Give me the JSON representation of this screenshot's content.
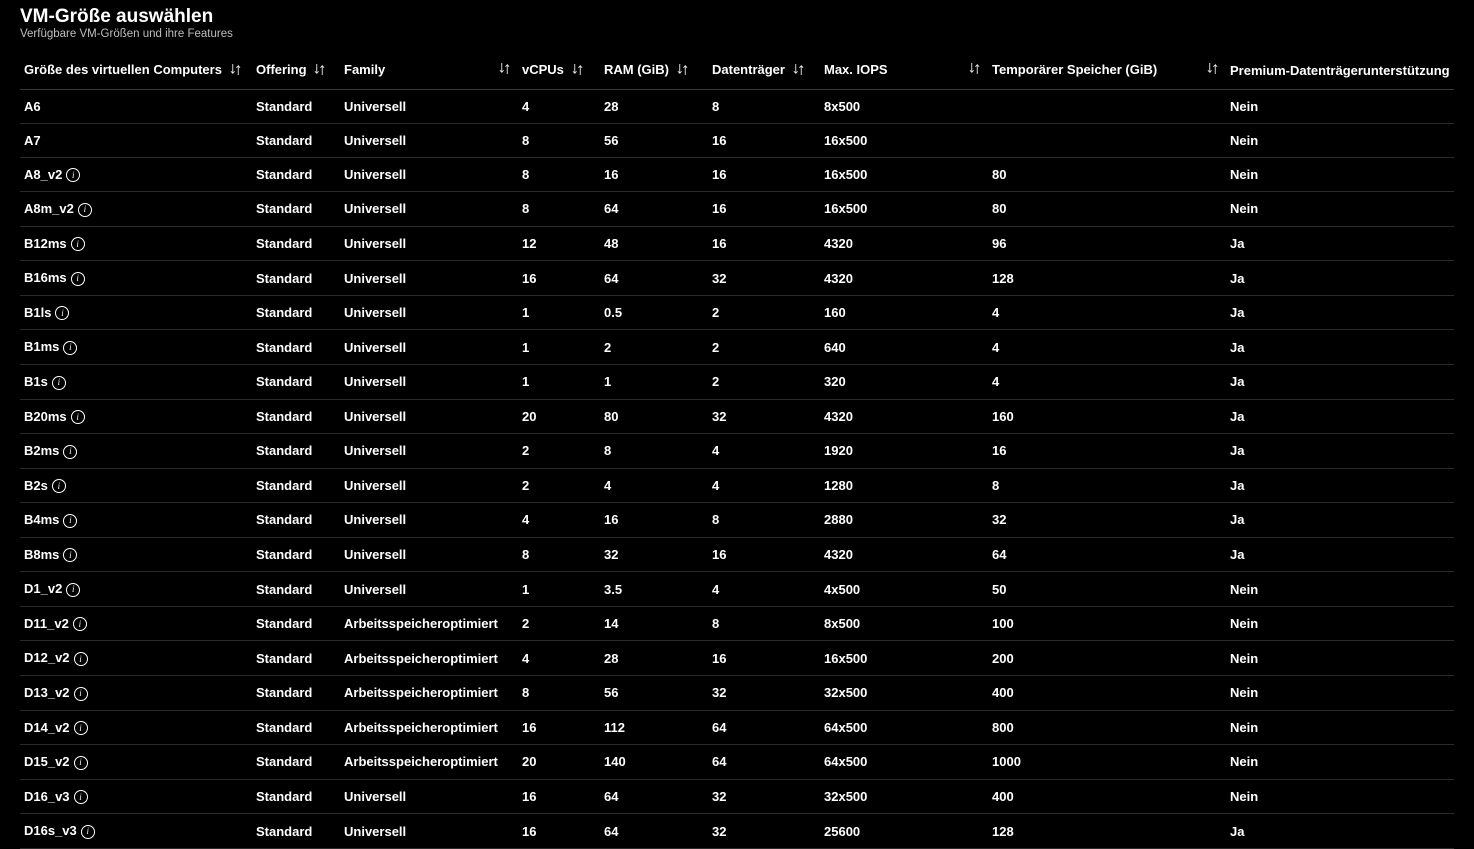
{
  "header": {
    "title": "VM-Größe auswählen",
    "subtitle": "Verfügbare VM-Größen und ihre Features"
  },
  "columns": {
    "size": {
      "label": "Größe des virtuellen Computers",
      "sortable": true,
      "sort_align": "left"
    },
    "offering": {
      "label": "Offering",
      "sortable": true,
      "sort_align": "left"
    },
    "family": {
      "label": "Family",
      "sortable": true,
      "sort_align": "right"
    },
    "vcpus": {
      "label": "vCPUs",
      "sortable": true,
      "sort_align": "left"
    },
    "ram": {
      "label": "RAM (GiB)",
      "sortable": true,
      "sort_align": "left"
    },
    "disks": {
      "label": "Datenträger",
      "sortable": true,
      "sort_align": "left"
    },
    "iops": {
      "label": "Max. IOPS",
      "sortable": true,
      "sort_align": "right"
    },
    "temp": {
      "label": "Temporärer Speicher (GiB)",
      "sortable": true,
      "sort_align": "right"
    },
    "premium": {
      "label": "Premium-Datenträgerunterstützung",
      "sortable": false
    }
  },
  "rows": [
    {
      "size": "A6",
      "info": false,
      "offering": "Standard",
      "family": "Universell",
      "vcpus": "4",
      "ram": "28",
      "disks": "8",
      "iops": "8x500",
      "temp": "",
      "premium": "Nein"
    },
    {
      "size": "A7",
      "info": false,
      "offering": "Standard",
      "family": "Universell",
      "vcpus": "8",
      "ram": "56",
      "disks": "16",
      "iops": "16x500",
      "temp": "",
      "premium": "Nein"
    },
    {
      "size": "A8_v2",
      "info": true,
      "offering": "Standard",
      "family": "Universell",
      "vcpus": "8",
      "ram": "16",
      "disks": "16",
      "iops": "16x500",
      "temp": "80",
      "premium": "Nein"
    },
    {
      "size": "A8m_v2",
      "info": true,
      "offering": "Standard",
      "family": "Universell",
      "vcpus": "8",
      "ram": "64",
      "disks": "16",
      "iops": "16x500",
      "temp": "80",
      "premium": "Nein"
    },
    {
      "size": "B12ms",
      "info": true,
      "offering": "Standard",
      "family": "Universell",
      "vcpus": "12",
      "ram": "48",
      "disks": "16",
      "iops": "4320",
      "temp": "96",
      "premium": "Ja"
    },
    {
      "size": "B16ms",
      "info": true,
      "offering": "Standard",
      "family": "Universell",
      "vcpus": "16",
      "ram": "64",
      "disks": "32",
      "iops": "4320",
      "temp": "128",
      "premium": "Ja"
    },
    {
      "size": "B1ls",
      "info": true,
      "offering": "Standard",
      "family": "Universell",
      "vcpus": "1",
      "ram": "0.5",
      "disks": "2",
      "iops": "160",
      "temp": "4",
      "premium": "Ja"
    },
    {
      "size": "B1ms",
      "info": true,
      "offering": "Standard",
      "family": "Universell",
      "vcpus": "1",
      "ram": "2",
      "disks": "2",
      "iops": "640",
      "temp": "4",
      "premium": "Ja"
    },
    {
      "size": "B1s",
      "info": true,
      "offering": "Standard",
      "family": "Universell",
      "vcpus": "1",
      "ram": "1",
      "disks": "2",
      "iops": "320",
      "temp": "4",
      "premium": "Ja"
    },
    {
      "size": "B20ms",
      "info": true,
      "offering": "Standard",
      "family": "Universell",
      "vcpus": "20",
      "ram": "80",
      "disks": "32",
      "iops": "4320",
      "temp": "160",
      "premium": "Ja"
    },
    {
      "size": "B2ms",
      "info": true,
      "offering": "Standard",
      "family": "Universell",
      "vcpus": "2",
      "ram": "8",
      "disks": "4",
      "iops": "1920",
      "temp": "16",
      "premium": "Ja"
    },
    {
      "size": "B2s",
      "info": true,
      "offering": "Standard",
      "family": "Universell",
      "vcpus": "2",
      "ram": "4",
      "disks": "4",
      "iops": "1280",
      "temp": "8",
      "premium": "Ja"
    },
    {
      "size": "B4ms",
      "info": true,
      "offering": "Standard",
      "family": "Universell",
      "vcpus": "4",
      "ram": "16",
      "disks": "8",
      "iops": "2880",
      "temp": "32",
      "premium": "Ja"
    },
    {
      "size": "B8ms",
      "info": true,
      "offering": "Standard",
      "family": "Universell",
      "vcpus": "8",
      "ram": "32",
      "disks": "16",
      "iops": "4320",
      "temp": "64",
      "premium": "Ja"
    },
    {
      "size": "D1_v2",
      "info": true,
      "offering": "Standard",
      "family": "Universell",
      "vcpus": "1",
      "ram": "3.5",
      "disks": "4",
      "iops": "4x500",
      "temp": "50",
      "premium": "Nein"
    },
    {
      "size": "D11_v2",
      "info": true,
      "offering": "Standard",
      "family": "Arbeitsspeicheroptimiert",
      "vcpus": "2",
      "ram": "14",
      "disks": "8",
      "iops": "8x500",
      "temp": "100",
      "premium": "Nein"
    },
    {
      "size": "D12_v2",
      "info": true,
      "offering": "Standard",
      "family": "Arbeitsspeicheroptimiert",
      "vcpus": "4",
      "ram": "28",
      "disks": "16",
      "iops": "16x500",
      "temp": "200",
      "premium": "Nein"
    },
    {
      "size": "D13_v2",
      "info": true,
      "offering": "Standard",
      "family": "Arbeitsspeicheroptimiert",
      "vcpus": "8",
      "ram": "56",
      "disks": "32",
      "iops": "32x500",
      "temp": "400",
      "premium": "Nein"
    },
    {
      "size": "D14_v2",
      "info": true,
      "offering": "Standard",
      "family": "Arbeitsspeicheroptimiert",
      "vcpus": "16",
      "ram": "112",
      "disks": "64",
      "iops": "64x500",
      "temp": "800",
      "premium": "Nein"
    },
    {
      "size": "D15_v2",
      "info": true,
      "offering": "Standard",
      "family": "Arbeitsspeicheroptimiert",
      "vcpus": "20",
      "ram": "140",
      "disks": "64",
      "iops": "64x500",
      "temp": "1000",
      "premium": "Nein"
    },
    {
      "size": "D16_v3",
      "info": true,
      "offering": "Standard",
      "family": "Universell",
      "vcpus": "16",
      "ram": "64",
      "disks": "32",
      "iops": "32x500",
      "temp": "400",
      "premium": "Nein"
    },
    {
      "size": "D16s_v3",
      "info": true,
      "offering": "Standard",
      "family": "Universell",
      "vcpus": "16",
      "ram": "64",
      "disks": "32",
      "iops": "25600",
      "temp": "128",
      "premium": "Ja"
    }
  ]
}
